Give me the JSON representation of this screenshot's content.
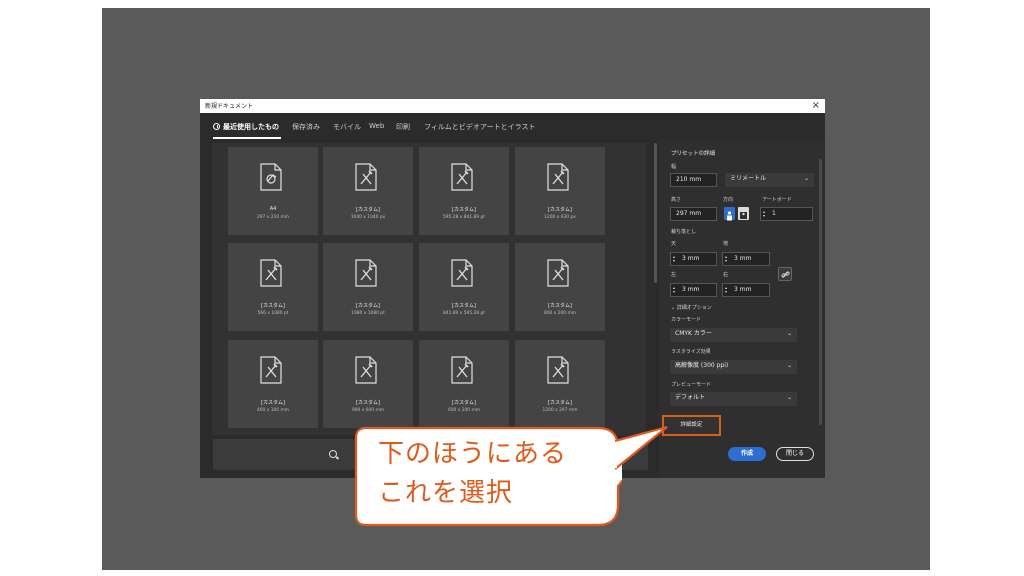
{
  "dialog": {
    "title": "新規ドキュメント",
    "close_glyph": "×",
    "tabs": [
      "最近使用したもの",
      "保存済み",
      "モバイル",
      "Web",
      "印刷",
      "フィルムとビデオ",
      "アートとイラスト"
    ]
  },
  "presets": [
    {
      "name": "A4",
      "size": "297 x 210 mm",
      "icon": "a4-document-icon"
    },
    {
      "name": "[カスタム]",
      "size": "1040 x 1040 px",
      "icon": "custom-document-icon"
    },
    {
      "name": "[カスタム]",
      "size": "595.28 x 841.89 pt",
      "icon": "custom-document-icon"
    },
    {
      "name": "[カスタム]",
      "size": "1200 x 630 px",
      "icon": "custom-document-icon"
    },
    {
      "name": "[カスタム]",
      "size": "566 x 1080 pt",
      "icon": "custom-document-icon"
    },
    {
      "name": "[カスタム]",
      "size": "1080 x 1080 pt",
      "icon": "custom-document-icon"
    },
    {
      "name": "[カスタム]",
      "size": "841.89 x 595.28 pt",
      "icon": "custom-document-icon"
    },
    {
      "name": "[カスタム]",
      "size": "800 x 200 mm",
      "icon": "custom-document-icon"
    },
    {
      "name": "[カスタム]",
      "size": "400 x 100 mm",
      "icon": "custom-document-icon"
    },
    {
      "name": "[カスタム]",
      "size": "900 x 600 mm",
      "icon": "custom-document-icon"
    },
    {
      "name": "[カスタム]",
      "size": "600 x 200 mm",
      "icon": "custom-document-icon"
    },
    {
      "name": "[カスタム]",
      "size": "1200 x 297 mm",
      "icon": "custom-document-icon"
    }
  ],
  "panel": {
    "heading": "プリセットの詳細",
    "width_label": "幅",
    "width_value": "210 mm",
    "unit_value": "ミリメートル",
    "height_label": "高さ",
    "height_value": "297 mm",
    "orientation_label": "方向",
    "artboard_label": "アートボード",
    "artboard_value": "1",
    "bleed_label": "裁ち落とし",
    "top_label": "天",
    "top_value": "3 mm",
    "bottom_label": "地",
    "bottom_value": "3 mm",
    "left_label": "左",
    "left_value": "3 mm",
    "right_label": "右",
    "right_value": "3 mm",
    "advanced_options_label": "詳細オプション",
    "color_mode_label": "カラーモード",
    "color_mode_value": "CMYK カラー",
    "raster_label": "ラスタライズ効果",
    "raster_value": "高解像度 (300 ppi)",
    "preview_label": "プレビューモード",
    "preview_value": "デフォルト",
    "advanced_settings_button": "詳細設定",
    "create_button": "作成",
    "close_button": "閉じる"
  },
  "annotation": {
    "line1": "下のほうにある",
    "line2": "これを選択",
    "color": "#e05a1b"
  }
}
